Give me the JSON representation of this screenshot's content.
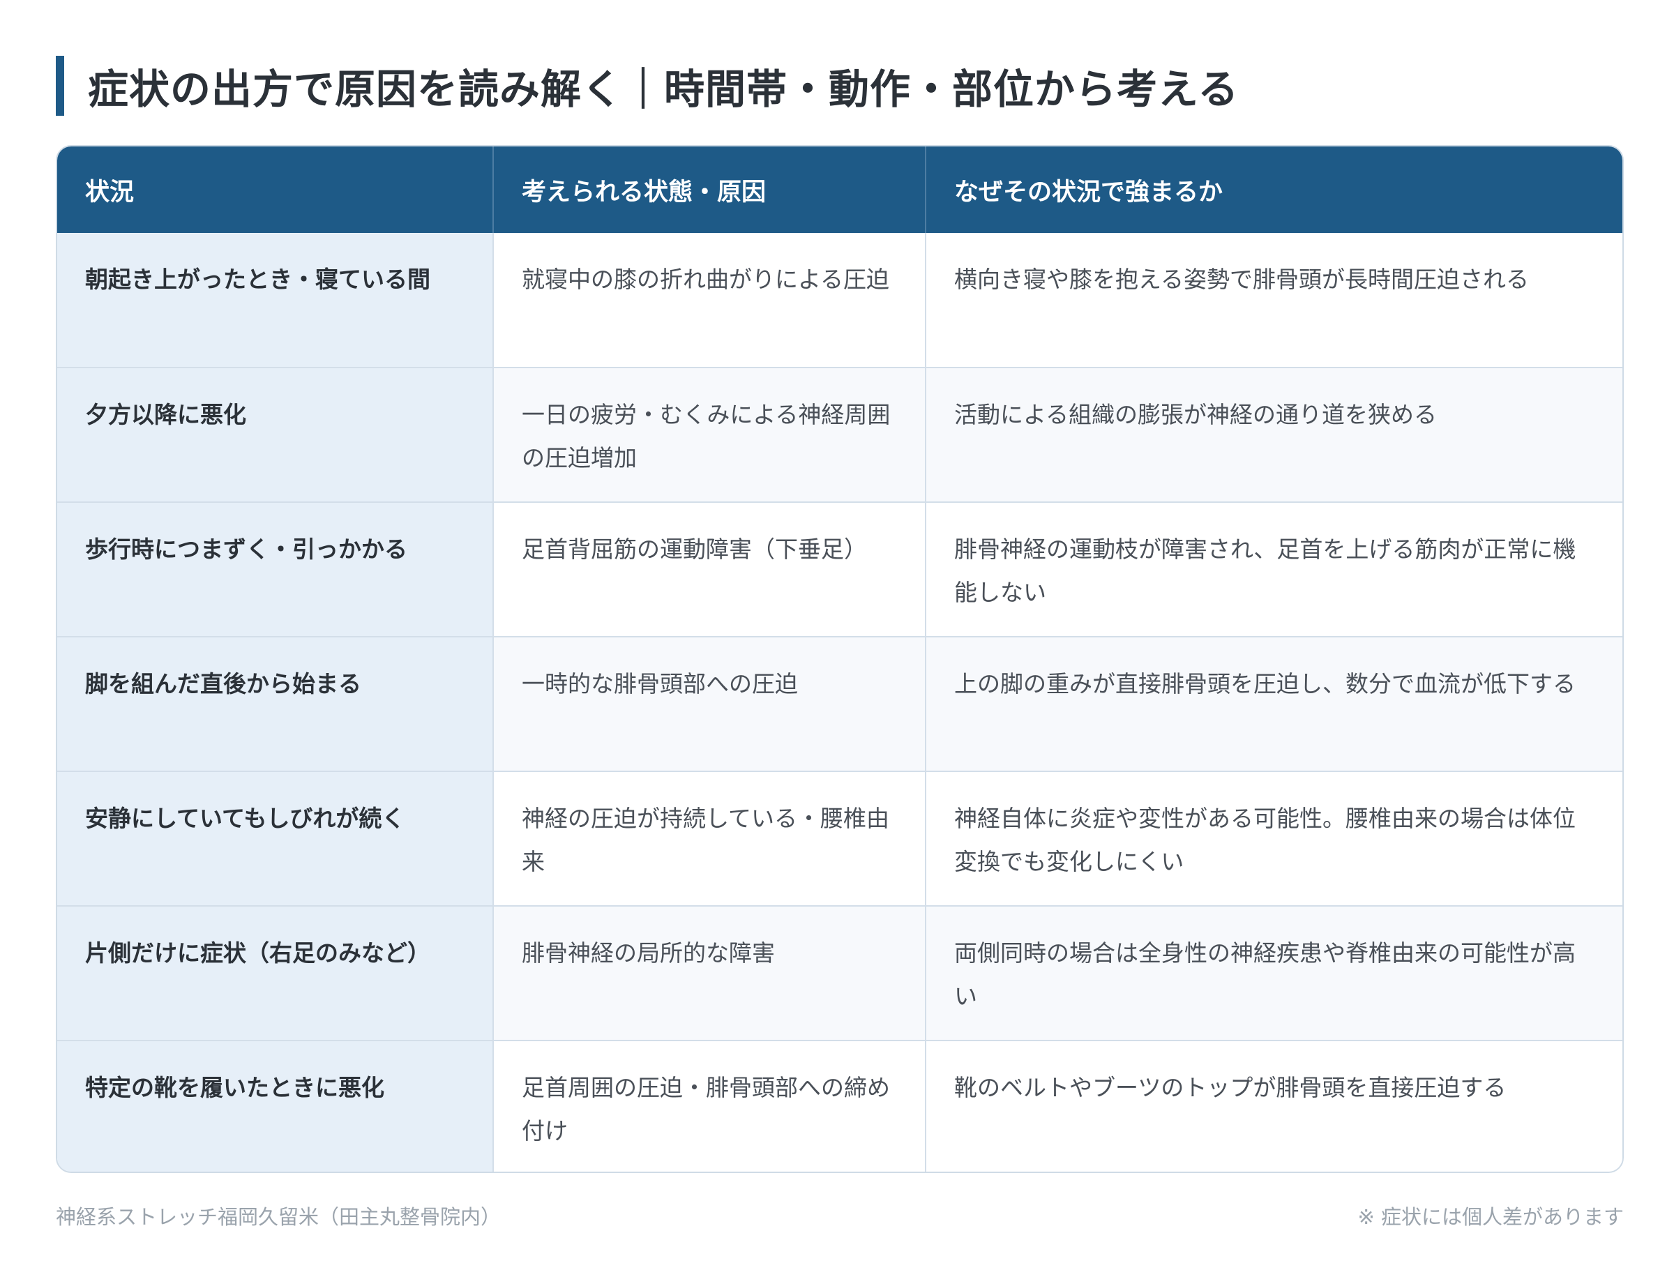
{
  "title": "症状の出方で原因を読み解く｜時間帯・動作・部位から考える",
  "table": {
    "headers": [
      "状況",
      "考えられる状態・原因",
      "なぜその状況で強まるか"
    ],
    "rows": [
      {
        "situation": "朝起き上がったとき・寝ている間",
        "cause": "就寝中の膝の折れ曲がりによる圧迫",
        "reason": "横向き寝や膝を抱える姿勢で腓骨頭が長時間圧迫される"
      },
      {
        "situation": "夕方以降に悪化",
        "cause": "一日の疲労・むくみによる神経周囲の圧迫増加",
        "reason": "活動による組織の膨張が神経の通り道を狭める"
      },
      {
        "situation": "歩行時につまずく・引っかかる",
        "cause": "足首背屈筋の運動障害（下垂足）",
        "reason": "腓骨神経の運動枝が障害され、足首を上げる筋肉が正常に機能しない"
      },
      {
        "situation": "脚を組んだ直後から始まる",
        "cause": "一時的な腓骨頭部への圧迫",
        "reason": "上の脚の重みが直接腓骨頭を圧迫し、数分で血流が低下する"
      },
      {
        "situation": "安静にしていてもしびれが続く",
        "cause": "神経の圧迫が持続している・腰椎由来",
        "reason": "神経自体に炎症や変性がある可能性。腰椎由来の場合は体位変換でも変化しにくい"
      },
      {
        "situation": "片側だけに症状（右足のみなど）",
        "cause": "腓骨神経の局所的な障害",
        "reason": "両側同時の場合は全身性の神経疾患や脊椎由来の可能性が高い"
      },
      {
        "situation": "特定の靴を履いたときに悪化",
        "cause": "足首周囲の圧迫・腓骨頭部への締め付け",
        "reason": "靴のベルトやブーツのトップが腓骨頭を直接圧迫する"
      }
    ]
  },
  "footer": {
    "source": "神経系ストレッチ福岡久留米（田主丸整骨院内）",
    "note": "※ 症状には個人差があります"
  },
  "colors": {
    "accent": "#1e5a87",
    "situation_bg": "#e6eff8",
    "border": "#d3dee9"
  }
}
